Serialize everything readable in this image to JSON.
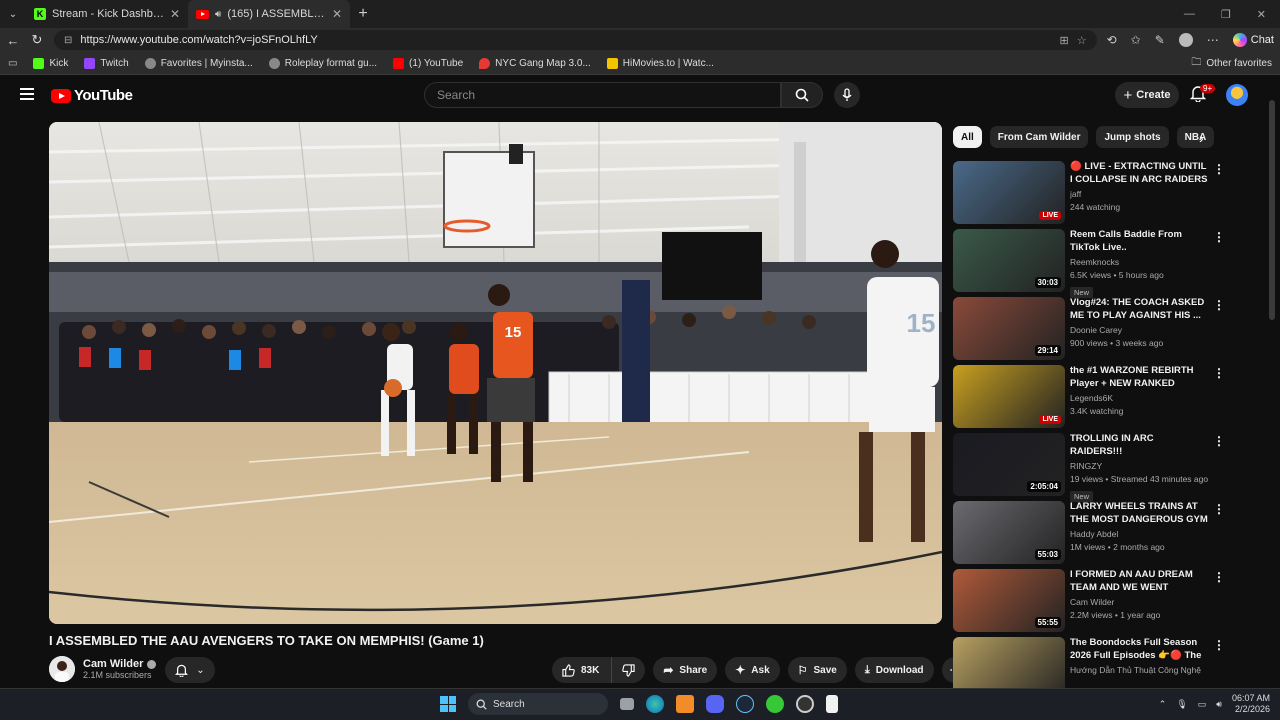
{
  "browser": {
    "tabs": [
      {
        "title": "Stream - Kick Dashboard",
        "icon": "kick-icon"
      },
      {
        "title": "(165) I ASSEMBLED THE AAU",
        "icon": "youtube-icon"
      }
    ],
    "url": "https://www.youtube.com/watch?v=joSFnOLhfLY",
    "chat_label": "Chat",
    "bookmarks": [
      {
        "label": "Kick",
        "color": "#53fc18"
      },
      {
        "label": "Twitch",
        "color": "#9146ff"
      },
      {
        "label": "Favorites | Myinsta...",
        "color": "#888888"
      },
      {
        "label": "Roleplay format gu...",
        "color": "#888888"
      },
      {
        "label": "(1) YouTube",
        "color": "#ff0000"
      },
      {
        "label": "NYC Gang Map 3.0...",
        "color": "#e53935"
      },
      {
        "label": "HiMovies.to | Watc...",
        "color": "#f5c400"
      }
    ],
    "other_favorites": "Other favorites"
  },
  "youtube": {
    "logo_text": "YouTube",
    "search_placeholder": "Search",
    "create_label": "Create",
    "notif_count": "9+"
  },
  "video": {
    "title": "I ASSEMBLED THE AAU AVENGERS TO TAKE ON MEMPHIS! (Game 1)",
    "channel": "Cam Wilder",
    "subscribers": "2.1M subscribers",
    "likes": "83K",
    "share": "Share",
    "ask": "Ask",
    "save": "Save",
    "download": "Download",
    "jersey_number": "15"
  },
  "chips": [
    "All",
    "From Cam Wilder",
    "Jump shots",
    "NBA"
  ],
  "recommendations": [
    {
      "title": "🔴 LIVE - EXTRACTING UNTIL I COLLAPSE IN ARC RAIDERS | ...",
      "channel": "jaff",
      "meta": "244 watching",
      "badge": "LIVE",
      "new": "",
      "thumb": "#4a6a8a"
    },
    {
      "title": "Reem Calls Baddie From TikTok Live..",
      "channel": "Reemknocks",
      "meta": "6.5K views • 5 hours ago",
      "badge": "30:03",
      "new": "New",
      "thumb": "#3a5a4a"
    },
    {
      "title": "Vlog#24: THE COACH ASKED ME TO PLAY AGAINST HIS ...",
      "channel": "Doonie Carey",
      "meta": "900 views • 3 weeks ago",
      "badge": "29:14",
      "new": "",
      "thumb": "#8a4a3a"
    },
    {
      "title": "the #1 WARZONE REBIRTH Player + NEW RANKED UPDATE",
      "channel": "Legends6K",
      "meta": "3.4K watching",
      "badge": "LIVE",
      "new": "",
      "thumb": "#c8a020"
    },
    {
      "title": "TROLLING IN ARC RAIDERS!!!",
      "channel": "RINGZY",
      "meta": "19 views • Streamed 43 minutes ago",
      "badge": "2:05:04",
      "new": "New",
      "thumb": "#1a1a22"
    },
    {
      "title": "LARRY WHEELS TRAINS AT THE MOST DANGEROUS GYM ...",
      "channel": "Haddy Abdel",
      "meta": "1M views • 2 months ago",
      "badge": "55:03",
      "new": "",
      "thumb": "#6a6a70"
    },
    {
      "title": "I FORMED AN AAU DREAM TEAM AND WE WENT INSANE!...",
      "channel": "Cam Wilder",
      "meta": "2.2M views • 1 year ago",
      "badge": "55:55",
      "new": "",
      "thumb": "#b05a3a"
    },
    {
      "title": "The Boondocks Full Season 2026 Full Episodes 👉🔴 The ...",
      "channel": "Hướng Dẫn Thủ Thuật Công Nghệ",
      "meta": "",
      "badge": "",
      "new": "",
      "thumb": "#b8a060"
    }
  ],
  "taskbar": {
    "search_label": "Search",
    "time": "06:07 AM",
    "date": "2/2/2026"
  }
}
